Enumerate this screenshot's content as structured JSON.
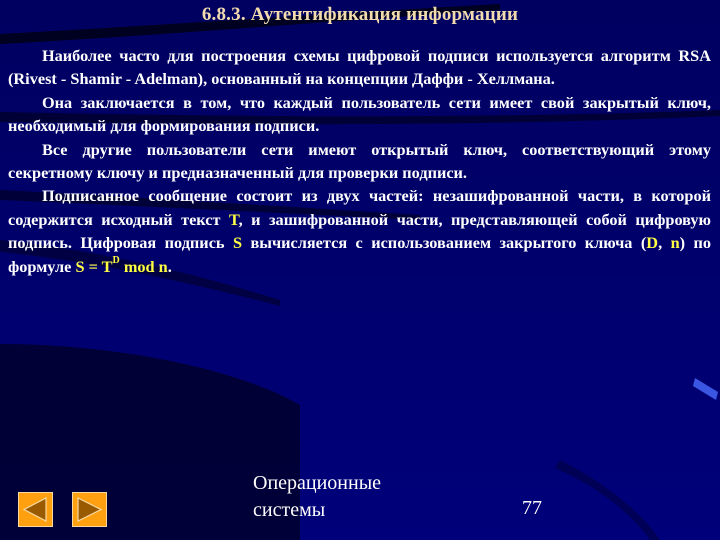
{
  "slide": {
    "title": "6.8.3. Аутентификация информации",
    "paragraphs": [
      {
        "segments": [
          {
            "text": "Наиболее часто для построения схемы цифровой подписи используется алгоритм RSA (Rivest - Shamir - Adelman), основанный на концепции Даффи - Хеллмана.",
            "highlight": false
          }
        ]
      },
      {
        "segments": [
          {
            "text": "Она заключается в том, что каждый пользователь сети имеет свой закрытый ключ, необходимый для формирования подписи.",
            "highlight": false
          }
        ]
      },
      {
        "segments": [
          {
            "text": "Все другие пользователи сети имеют открытый ключ, соответствующий этому секретному ключу и предназначенный для проверки подписи.",
            "highlight": false
          }
        ]
      },
      {
        "segments": [
          {
            "text": "Подписанное сообщение состоит из двух частей: незашифрованной части, в которой содержится исходный текст ",
            "highlight": false
          },
          {
            "text": "T",
            "highlight": true
          },
          {
            "text": ", и зашифрованной части, представляющей собой цифровую подпись. Цифровая подпись ",
            "highlight": false
          },
          {
            "text": "S",
            "highlight": true
          },
          {
            "text": " вычисляется с использованием закрытого ключа (",
            "highlight": false
          },
          {
            "text": "D",
            "highlight": true
          },
          {
            "text": ", ",
            "highlight": false
          },
          {
            "text": "n",
            "highlight": true
          },
          {
            "text": ") по формуле ",
            "highlight": false
          },
          {
            "text": "S = T",
            "highlight": true
          },
          {
            "text": "D",
            "highlight": true,
            "sup": true
          },
          {
            "text": " mod n",
            "highlight": true
          },
          {
            "text": ".",
            "highlight": false
          }
        ]
      }
    ]
  },
  "footer": {
    "course_line1": "Операционные",
    "course_line2": "системы",
    "page_number": "77"
  },
  "nav": {
    "prev_icon": "triangle-left-icon",
    "next_icon": "triangle-right-icon"
  },
  "colors": {
    "background": "#00006a",
    "title": "#f2dcae",
    "text": "#ffffff",
    "highlight": "#ffff44",
    "nav_button": "#ffa010",
    "nav_arrow": "#9a5a00"
  }
}
